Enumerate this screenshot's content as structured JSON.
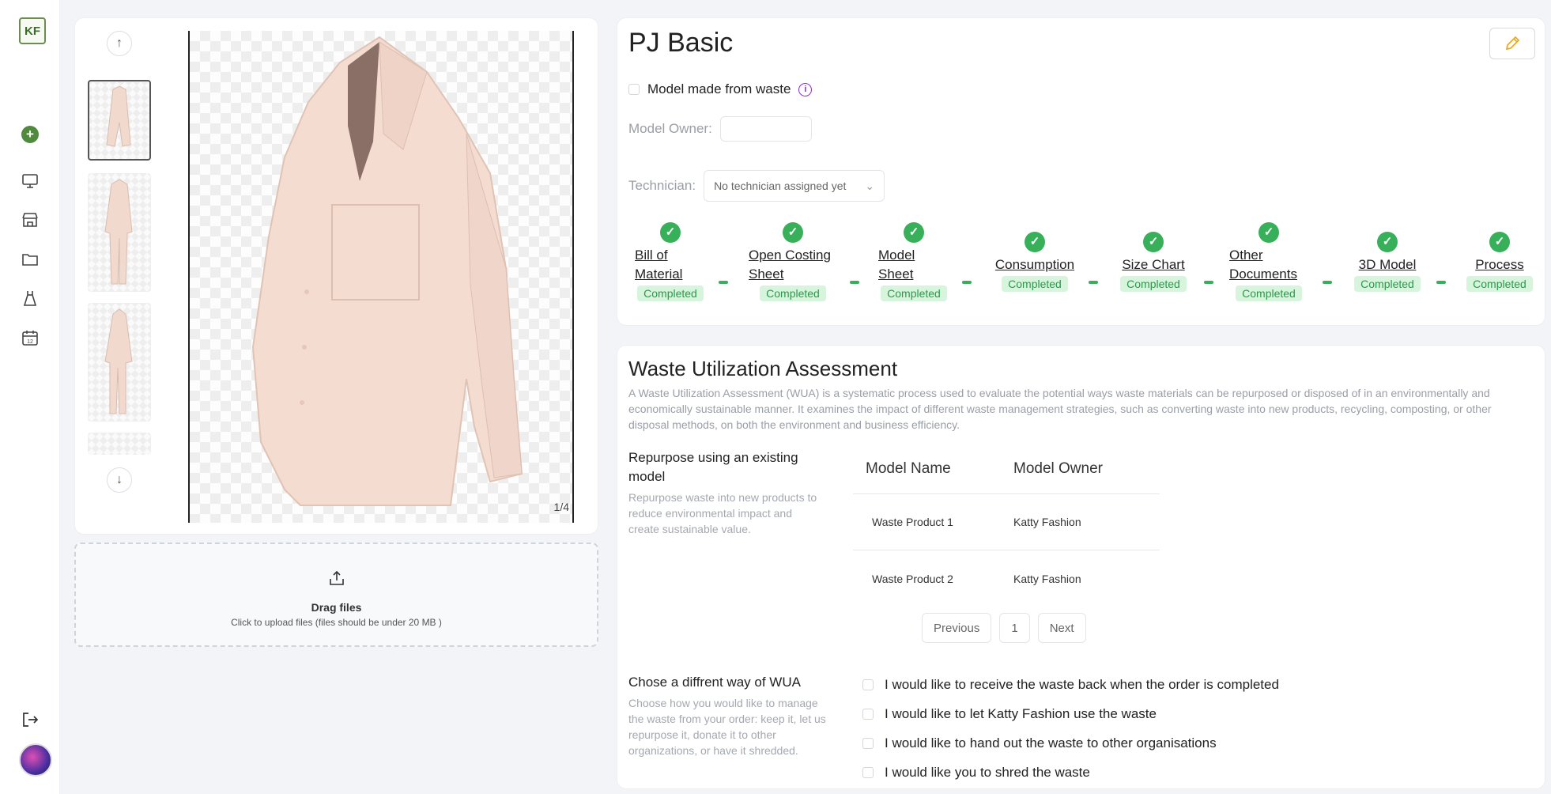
{
  "sidebar": {
    "logo_text": "KF",
    "items": [
      "add-icon",
      "monitor-icon",
      "store-icon",
      "folder-icon",
      "dress-icon",
      "calendar-icon"
    ],
    "logout_icon": "logout-icon"
  },
  "gallery": {
    "counter": "1/4",
    "upload_title": "Drag files",
    "upload_sub": "Click to upload files (files should be under 20 MB )"
  },
  "model": {
    "title": "PJ Basic",
    "waste_label": "Model made from waste",
    "owner_label": "Model Owner:",
    "owner_value": "",
    "technician_label": "Technician:",
    "technician_value": "No technician assigned yet"
  },
  "steps": [
    {
      "label": "Bill of Material",
      "status": "Completed"
    },
    {
      "label": "Open Costing Sheet",
      "status": "Completed"
    },
    {
      "label": "Model Sheet",
      "status": "Completed"
    },
    {
      "label": "Consumption",
      "status": "Completed"
    },
    {
      "label": "Size Chart",
      "status": "Completed"
    },
    {
      "label": "Other Documents",
      "status": "Completed"
    },
    {
      "label": "3D Model",
      "status": "Completed"
    },
    {
      "label": "Process",
      "status": "Completed"
    }
  ],
  "wua": {
    "title": "Waste Utilization Assessment",
    "description": "A Waste Utilization Assessment (WUA) is a systematic process used to evaluate the potential ways waste materials can be repurposed or disposed of in an environmentally and economically sustainable manner. It examines the impact of different waste management strategies, such as converting waste into new products, recycling, composting, or other disposal methods, on both the environment and business efficiency.",
    "repurpose_title": "Repurpose using an existing model",
    "repurpose_desc": "Repurpose waste into new products to reduce environmental impact and create sustainable value.",
    "table_headers": [
      "Model Name",
      "Model Owner"
    ],
    "table_rows": [
      [
        "Waste Product 1",
        "Katty Fashion"
      ],
      [
        "Waste Product 2",
        "Katty Fashion"
      ]
    ],
    "pager": {
      "previous": "Previous",
      "page": "1",
      "next": "Next"
    },
    "alt_title": "Chose a diffrent way of WUA",
    "alt_desc": "Choose how you would like to manage the waste from your order: keep it, let us repurpose it, donate it to other organizations, or have it shredded.",
    "options": [
      "I would like to receive the waste back when the order is completed",
      "I would like to let Katty Fashion use the waste",
      "I would like to hand out the waste to other organisations",
      "I would like you to shred the waste"
    ]
  }
}
